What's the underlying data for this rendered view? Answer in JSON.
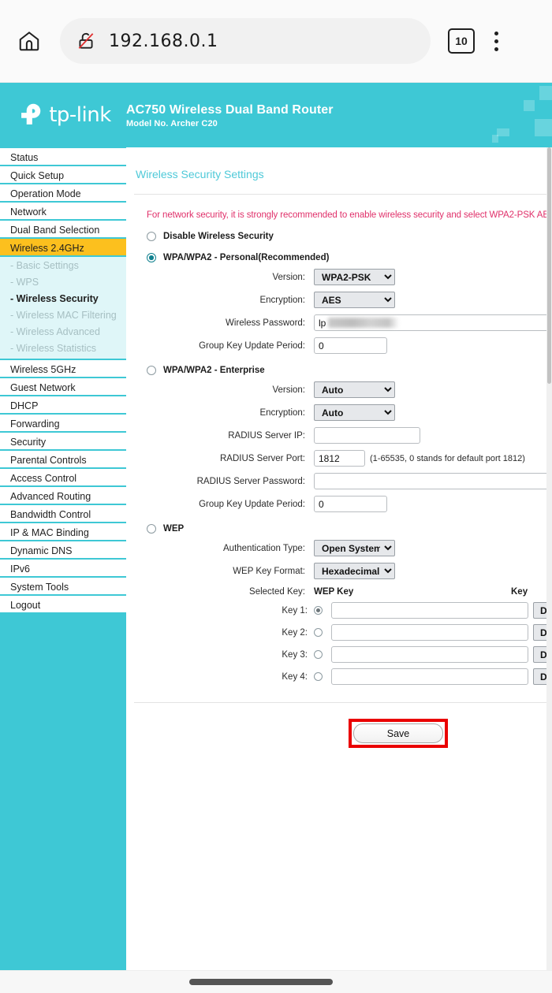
{
  "browser": {
    "home_icon": "home-icon",
    "lock_icon": "lock-crossed-out-icon",
    "url": "192.168.0.1",
    "tab_count": "10",
    "menu_icon": "kebab-menu-icon"
  },
  "router_header": {
    "brand": "tp-link",
    "title": "AC750 Wireless Dual Band Router",
    "model": "Model No. Archer C20"
  },
  "sidebar": {
    "items": [
      {
        "label": "Status",
        "active": false
      },
      {
        "label": "Quick Setup",
        "active": false
      },
      {
        "label": "Operation Mode",
        "active": false
      },
      {
        "label": "Network",
        "active": false
      },
      {
        "label": "Dual Band Selection",
        "active": false
      },
      {
        "label": "Wireless 2.4GHz",
        "active": true
      }
    ],
    "submenu": [
      {
        "label": "- Basic Settings",
        "current": false
      },
      {
        "label": "- WPS",
        "current": false
      },
      {
        "label": "- Wireless Security",
        "current": true
      },
      {
        "label": "- Wireless MAC Filtering",
        "current": false
      },
      {
        "label": "- Wireless Advanced",
        "current": false
      },
      {
        "label": "- Wireless Statistics",
        "current": false
      }
    ],
    "items_after": [
      {
        "label": "Wireless 5GHz"
      },
      {
        "label": "Guest Network"
      },
      {
        "label": "DHCP"
      },
      {
        "label": "Forwarding"
      },
      {
        "label": "Security"
      },
      {
        "label": "Parental Controls"
      },
      {
        "label": "Access Control"
      },
      {
        "label": "Advanced Routing"
      },
      {
        "label": "Bandwidth Control"
      },
      {
        "label": "IP & MAC Binding"
      },
      {
        "label": "Dynamic DNS"
      },
      {
        "label": "IPv6"
      },
      {
        "label": "System Tools"
      },
      {
        "label": "Logout"
      }
    ]
  },
  "main": {
    "section_title": "Wireless Security Settings",
    "warning": "For network security, it is strongly recommended to enable wireless security and select WPA2-PSK AE",
    "disable_option": "Disable Wireless Security",
    "personal": {
      "option_label": "WPA/WPA2 - Personal(Recommended)",
      "version_label": "Version:",
      "version_value": "WPA2-PSK",
      "encryption_label": "Encryption:",
      "encryption_value": "AES",
      "password_label": "Wireless Password:",
      "password_value": "lp",
      "group_key_label": "Group Key Update Period:",
      "group_key_value": "0"
    },
    "enterprise": {
      "option_label": "WPA/WPA2 - Enterprise",
      "version_label": "Version:",
      "version_value": "Auto",
      "encryption_label": "Encryption:",
      "encryption_value": "Auto",
      "radius_ip_label": "RADIUS Server IP:",
      "radius_ip_value": "",
      "radius_port_label": "RADIUS Server Port:",
      "radius_port_value": "1812",
      "radius_port_hint": "(1-65535, 0 stands for default port 1812)",
      "radius_password_label": "RADIUS Server Password:",
      "radius_password_value": "",
      "group_key_label": "Group Key Update Period:",
      "group_key_value": "0"
    },
    "wep": {
      "option_label": "WEP",
      "auth_type_label": "Authentication Type:",
      "auth_type_value": "Open System",
      "key_format_label": "WEP Key Format:",
      "key_format_value": "Hexadecimal",
      "selected_key_label": "Selected Key:",
      "wep_key_col": "WEP Key",
      "key_type_col": "Key",
      "keys": [
        {
          "label": "Key 1:",
          "value": "",
          "type": "D",
          "selected": true
        },
        {
          "label": "Key 2:",
          "value": "",
          "type": "D",
          "selected": false
        },
        {
          "label": "Key 3:",
          "value": "",
          "type": "D",
          "selected": false
        },
        {
          "label": "Key 4:",
          "value": "",
          "type": "D",
          "selected": false
        }
      ]
    },
    "save_label": "Save"
  },
  "colors": {
    "brand_teal": "#3ec8d5",
    "accent_yellow": "#fcc01e",
    "warning_pink": "#e0306a",
    "highlight_red": "#ea0000"
  }
}
